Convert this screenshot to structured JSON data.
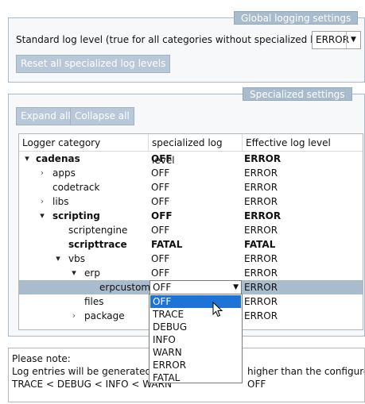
{
  "global_settings": {
    "legend": "Global logging settings",
    "standard_label": "Standard log level (true for all categories without specialized loglevel):",
    "standard_value": "ERROR",
    "reset_button": "Reset all specialized log levels"
  },
  "specialized_settings": {
    "legend": "Specialized settings",
    "expand_button": "Expand all",
    "collapse_button": "Collapse all",
    "columns": [
      "Logger category",
      "specialized log level",
      "Effective log level"
    ],
    "rows": [
      {
        "name": "cadenas",
        "specialized": "OFF",
        "effective": "ERROR"
      },
      {
        "name": "apps",
        "specialized": "OFF",
        "effective": "ERROR"
      },
      {
        "name": "codetrack",
        "specialized": "OFF",
        "effective": "ERROR"
      },
      {
        "name": "libs",
        "specialized": "OFF",
        "effective": "ERROR"
      },
      {
        "name": "scripting",
        "specialized": "OFF",
        "effective": "ERROR"
      },
      {
        "name": "scriptengine",
        "specialized": "OFF",
        "effective": "ERROR"
      },
      {
        "name": "scripttrace",
        "specialized": "FATAL",
        "effective": "FATAL"
      },
      {
        "name": "vbs",
        "specialized": "OFF",
        "effective": "ERROR"
      },
      {
        "name": "erp",
        "specialized": "OFF",
        "effective": "ERROR"
      },
      {
        "name": "erpcustom",
        "specialized": "OFF",
        "effective": "ERROR"
      },
      {
        "name": "files",
        "specialized": "",
        "effective": "ERROR"
      },
      {
        "name": "package",
        "specialized": "",
        "effective": "ERROR"
      }
    ],
    "dropdown_options": [
      "OFF",
      "TRACE",
      "DEBUG",
      "INFO",
      "WARN",
      "ERROR",
      "FATAL"
    ],
    "dropdown_selected": "OFF"
  },
  "note": {
    "line1": "Please note:",
    "line2_a": "Log entries will be generated if th",
    "line2_b": "higher than the configured lo",
    "line3_a": "TRACE < DEBUG < INFO < WARN",
    "line3_b": "OFF"
  },
  "icons": {
    "expanded": "▾",
    "collapsed": "›",
    "combo_arrow": "▼"
  },
  "colors": {
    "group_header": "#a9bccd",
    "selection": "#a9bccd",
    "dropdown_highlight": "#1e73d6"
  }
}
